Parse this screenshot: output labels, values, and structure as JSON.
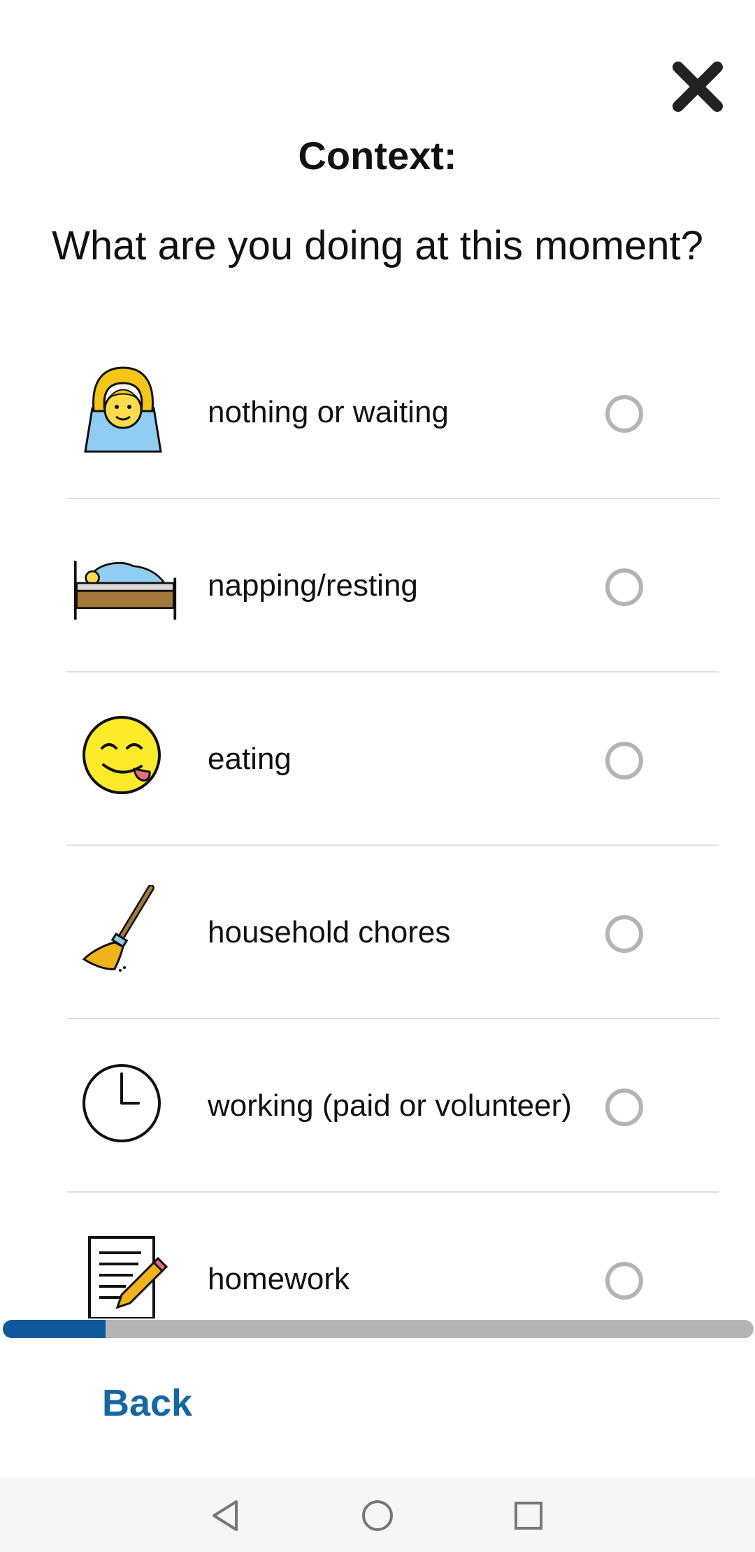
{
  "header": {
    "close_icon": "close-x-icon"
  },
  "section_title": "Context:",
  "question": "What are you doing at this moment?",
  "options": [
    {
      "label": "nothing or waiting",
      "icon": "person-waiting-icon",
      "selected": false
    },
    {
      "label": "napping/resting",
      "icon": "bed-icon",
      "selected": false
    },
    {
      "label": "eating",
      "icon": "face-savoring-food-icon",
      "selected": false
    },
    {
      "label": "household chores",
      "icon": "broom-icon",
      "selected": false
    },
    {
      "label": "working (paid or volunteer)",
      "icon": "clock-icon",
      "selected": false
    },
    {
      "label": "homework",
      "icon": "memo-pencil-icon",
      "selected": false
    }
  ],
  "progress": {
    "fraction": 0.137
  },
  "footer": {
    "back_label": "Back"
  },
  "colors": {
    "accent": "#1368a4",
    "progress_fill": "#0e5a9c",
    "progress_track": "#b4b4b4",
    "divider": "#dedede"
  },
  "system_nav": [
    "back-triangle-icon",
    "home-circle-icon",
    "recents-square-icon"
  ]
}
